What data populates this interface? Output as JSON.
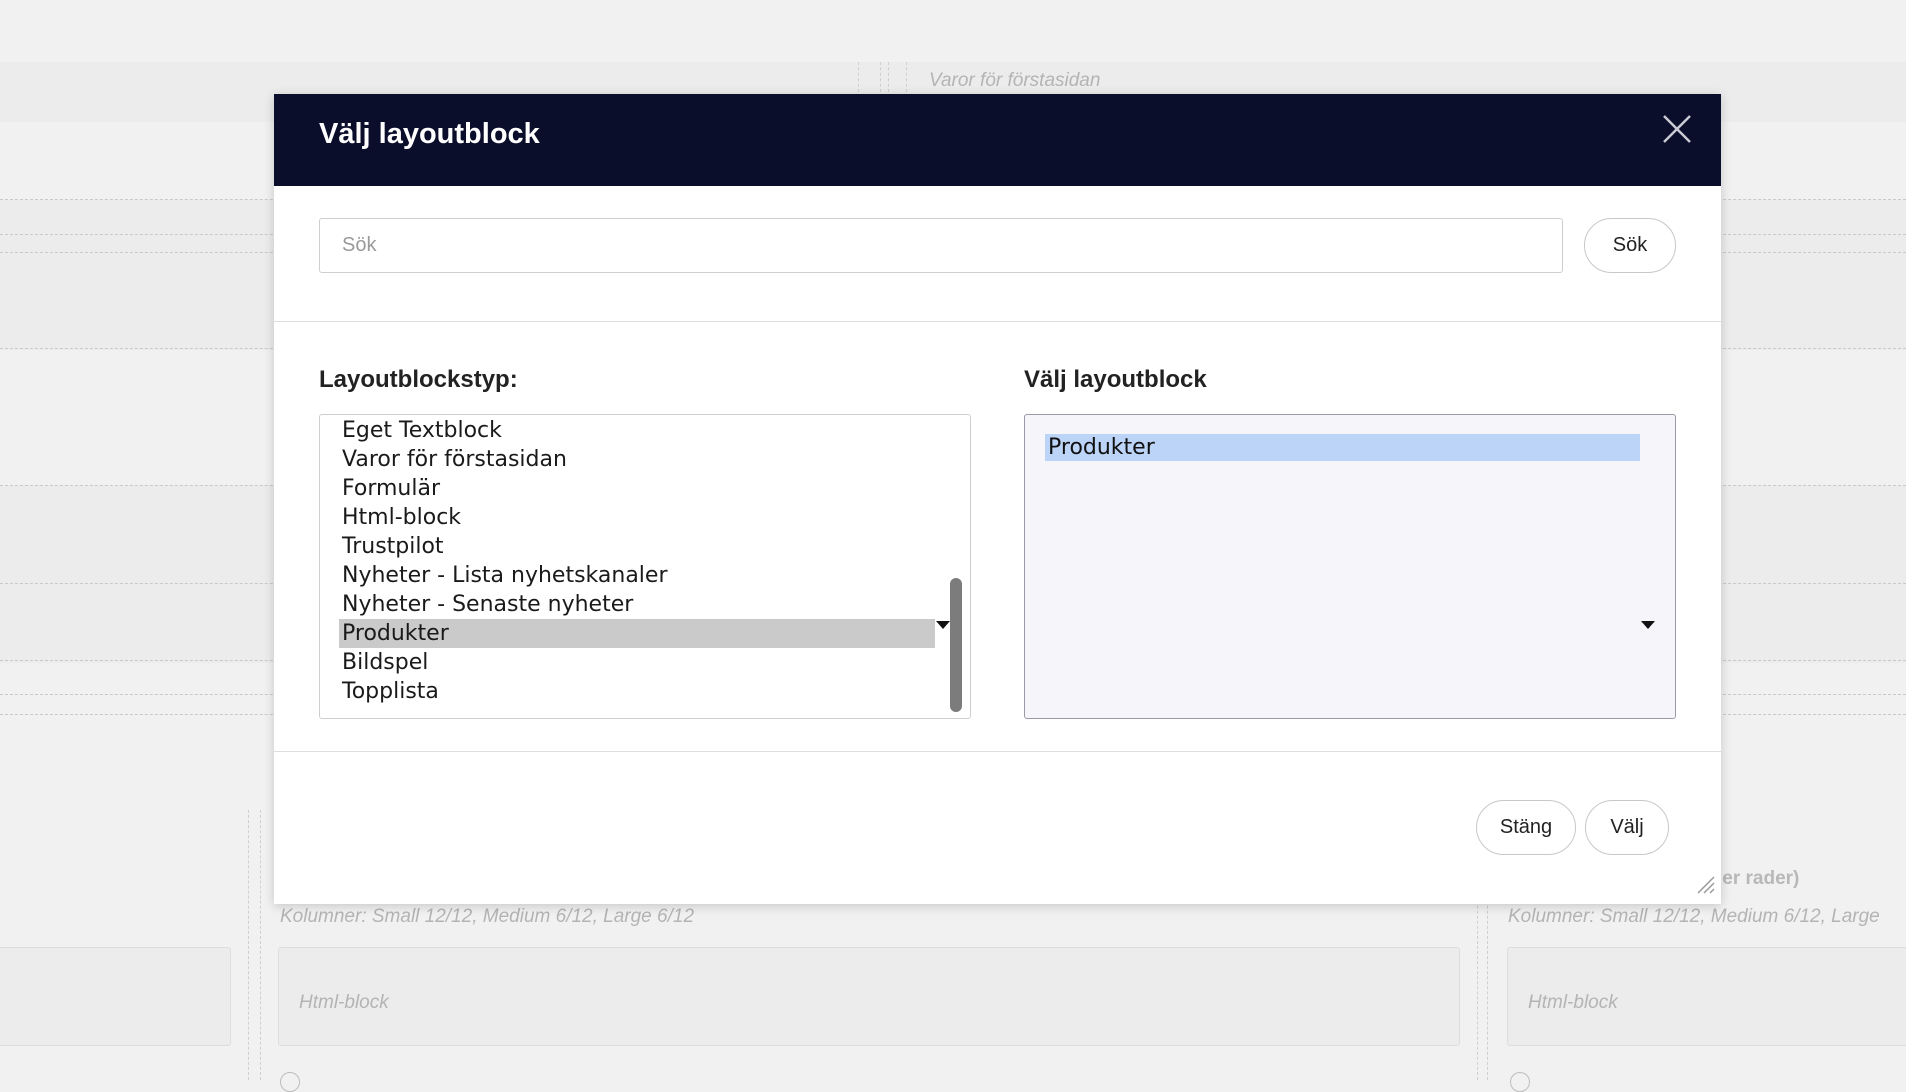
{
  "background": {
    "top_block_label": "Varor för förstasidan",
    "columns_label_left": "Kolumner: Small 12/12, Medium 6/12, Large 6/12",
    "columns_label_right": "Kolumner: Small 12/12, Medium 6/12, Large",
    "card_label_left": "Html-block",
    "card_label_right": "Html-block",
    "partial_heading": "ler rader)"
  },
  "modal": {
    "title": "Välj layoutblock",
    "close_icon": "close-icon",
    "search": {
      "placeholder": "Sök",
      "value": "",
      "button_label": "Sök"
    },
    "type_column": {
      "label": "Layoutblockstyp:",
      "options": [
        "Eget Textblock",
        "Varor för förstasidan",
        "Formulär",
        "Html-block",
        "Trustpilot",
        "Nyheter - Lista nyhetskanaler",
        "Nyheter - Senaste nyheter",
        "Produkter",
        "Bildspel",
        "Topplista"
      ],
      "selected": "Produkter"
    },
    "block_column": {
      "label": "Välj layoutblock",
      "options": [
        "Produkter"
      ],
      "selected": "Produkter"
    },
    "footer": {
      "close_label": "Stäng",
      "select_label": "Välj"
    }
  },
  "colors": {
    "header_bg": "#0b0e2a",
    "selected_gray": "#cacaca",
    "selected_blue": "#bcd4f8"
  }
}
